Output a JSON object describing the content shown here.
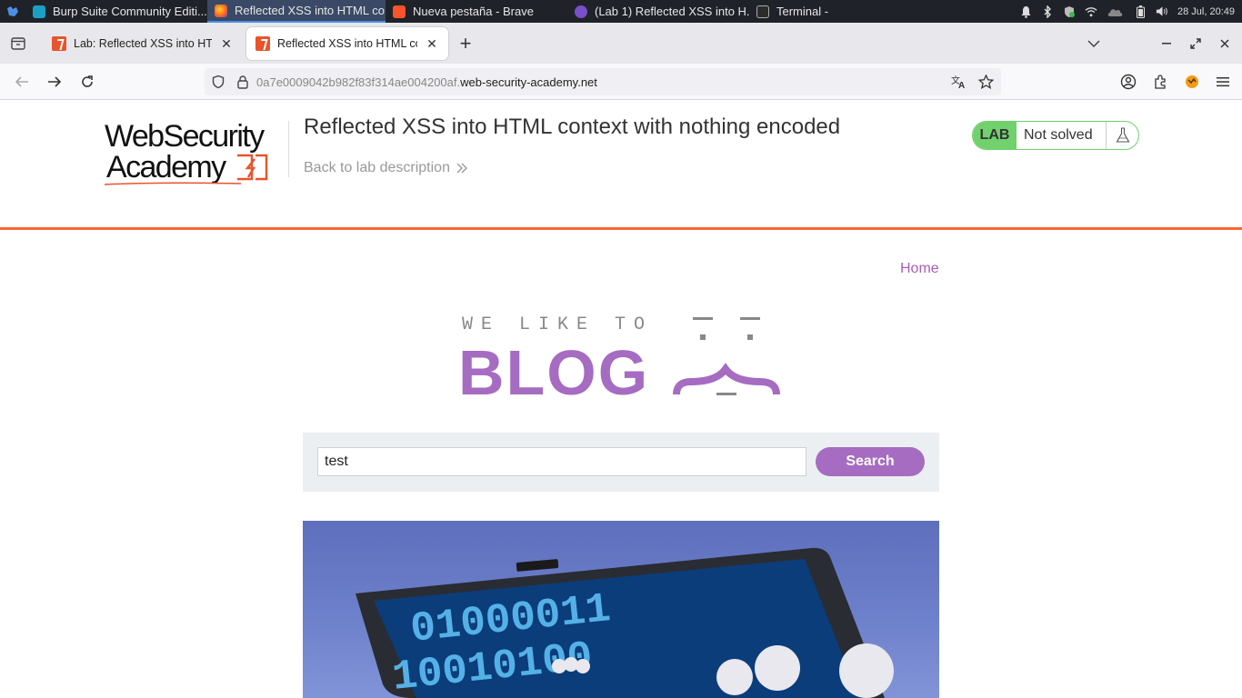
{
  "taskbar": {
    "tasks": [
      {
        "label": "Burp Suite Community Editi..."
      },
      {
        "label": "Reflected XSS into HTML co..."
      },
      {
        "label": "Nueva pestaña - Brave"
      },
      {
        "label": "(Lab 1) Reflected XSS into H..."
      },
      {
        "label": "Terminal -"
      }
    ],
    "clock": "28 Jul, 20:49"
  },
  "browser": {
    "tabs": [
      {
        "label": "Lab: Reflected XSS into HTML"
      },
      {
        "label": "Reflected XSS into HTML cont"
      }
    ],
    "url_host": "0a7e0009042b982f83f314ae004200af.",
    "url_domain": "web-security-academy.net"
  },
  "lab": {
    "logo_line1": "WebSecurity",
    "logo_line2": "Academy",
    "title": "Reflected XSS into HTML context with nothing encoded",
    "back_link": "Back to lab description",
    "badge": "LAB",
    "status": "Not solved"
  },
  "blog": {
    "home_link": "Home",
    "tagline": "WE LIKE TO",
    "logo_word": "BLOG",
    "search_value": "test",
    "search_button": "Search"
  },
  "colors": {
    "accent_orange": "#ff6633",
    "blog_purple": "#a56cc1",
    "lab_green": "#70d16d"
  }
}
